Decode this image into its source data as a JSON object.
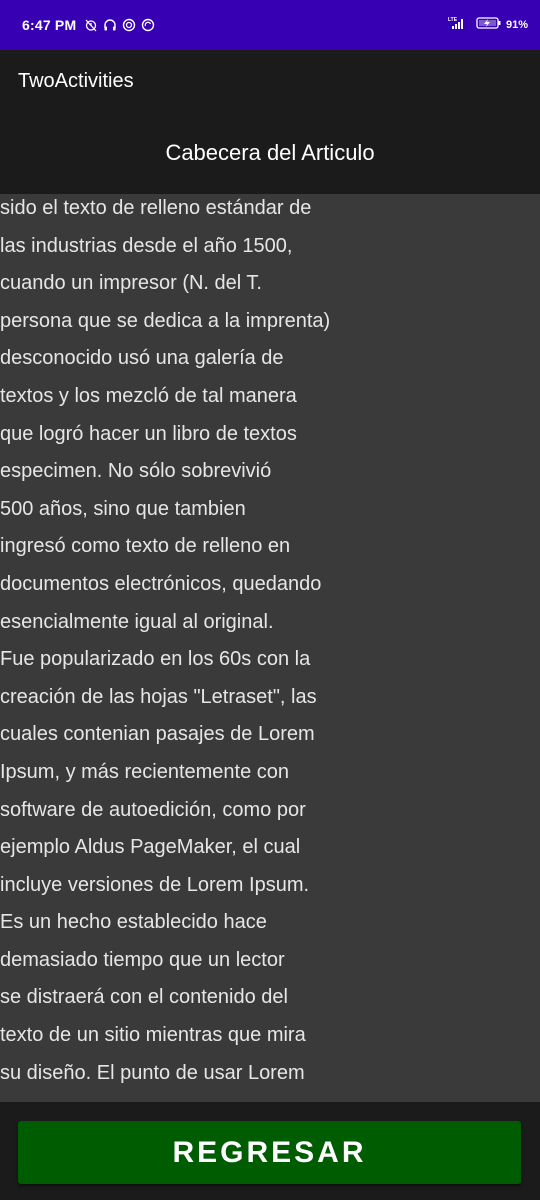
{
  "status_bar": {
    "time": "6:47 PM",
    "battery_percent": "91",
    "network_label": "LTE",
    "icons": [
      "alarm-off-icon",
      "headset-icon",
      "sync-icon",
      "sync-alt-icon",
      "signal-icon",
      "battery-charging-icon"
    ]
  },
  "app_bar": {
    "title": "TwoActivities"
  },
  "article": {
    "heading": "Cabecera del Articulo",
    "body": "sido el texto de relleno estándar de\nlas industrias desde el año 1500,\ncuando un impresor (N. del T.\npersona que se dedica a la imprenta)\ndesconocido usó una galería de\ntextos y los mezcló de tal manera\nque logró hacer un libro de textos\nespecimen. No sólo sobrevivió\n500 años, sino que tambien\ningresó como texto de relleno en\ndocumentos electrónicos, quedando\nesencialmente igual al original.\nFue popularizado en los 60s con la\ncreación de las hojas \"Letraset\", las\ncuales contenian pasajes de Lorem\nIpsum, y más recientemente con\nsoftware de autoedición, como por\nejemplo Aldus PageMaker, el cual\nincluye versiones de Lorem Ipsum.\nEs un hecho establecido hace\ndemasiado tiempo que un lector\nse distraerá con el contenido del\ntexto de un sitio mientras que mira\nsu diseño. El punto de usar Lorem"
  },
  "actions": {
    "back_label": "REGRESAR"
  },
  "colors": {
    "status_bar": "#3700b3",
    "app_bar": "#1b1b1b",
    "article_background": "#3a3a3a",
    "button": "#005c00"
  }
}
